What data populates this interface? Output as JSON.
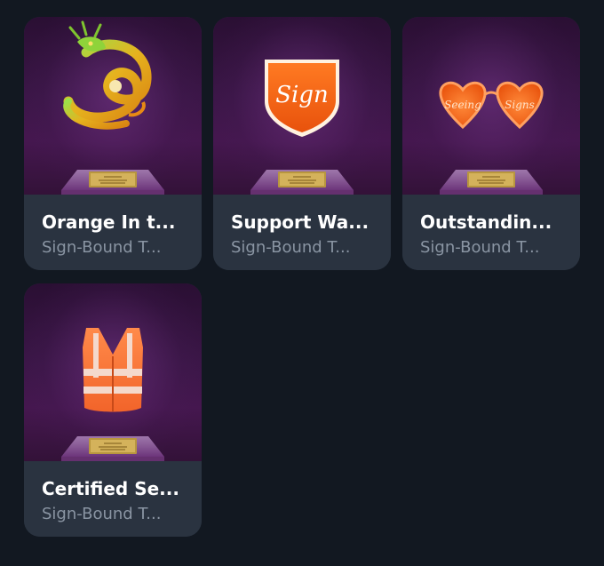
{
  "cards": [
    {
      "title": "Orange In t...",
      "subtitle": "Sign-Bound T...",
      "icon": "dragon-trophy-icon"
    },
    {
      "title": "Support Wa...",
      "subtitle": "Sign-Bound T...",
      "icon": "sign-shield-trophy-icon",
      "artwork_text": "Sign"
    },
    {
      "title": "Outstandin...",
      "subtitle": "Sign-Bound T...",
      "icon": "heart-glasses-trophy-icon",
      "artwork_text_left": "Seeing",
      "artwork_text_right": "Signs"
    },
    {
      "title": "Certified Se...",
      "subtitle": "Sign-Bound T...",
      "icon": "safety-vest-trophy-icon"
    }
  ],
  "colors": {
    "background": "#121821",
    "card_footer": "#2a3340",
    "title": "#ffffff",
    "subtitle": "#8a95a3",
    "accent_orange": "#ff6a1a"
  }
}
